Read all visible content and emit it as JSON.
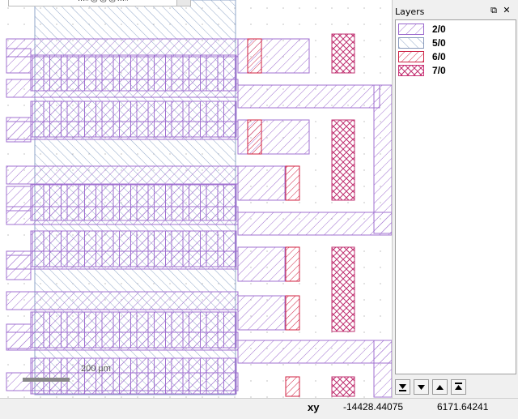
{
  "window": {
    "partial_title": "...#@@@...#",
    "tab_close": "x"
  },
  "canvas": {
    "scale_bar_label": "200 µm"
  },
  "layers_panel": {
    "title": "Layers",
    "float_button": "⧉",
    "close_button": "✕",
    "layers": [
      {
        "name": "2/0",
        "color": "#9966cc",
        "pattern": "hatch-forward"
      },
      {
        "name": "5/0",
        "color": "#8899bb",
        "pattern": "hatch-back"
      },
      {
        "name": "6/0",
        "color": "#cc2244",
        "pattern": "hatch-forward"
      },
      {
        "name": "7/0",
        "color": "#cc3377",
        "pattern": "cross-hatch"
      }
    ],
    "nav_buttons": [
      "move-to-bottom",
      "move-down",
      "move-up",
      "move-to-top"
    ]
  },
  "status_bar": {
    "label": "xy",
    "x_value": "-14428.44075",
    "y_value": "6171.64241"
  }
}
